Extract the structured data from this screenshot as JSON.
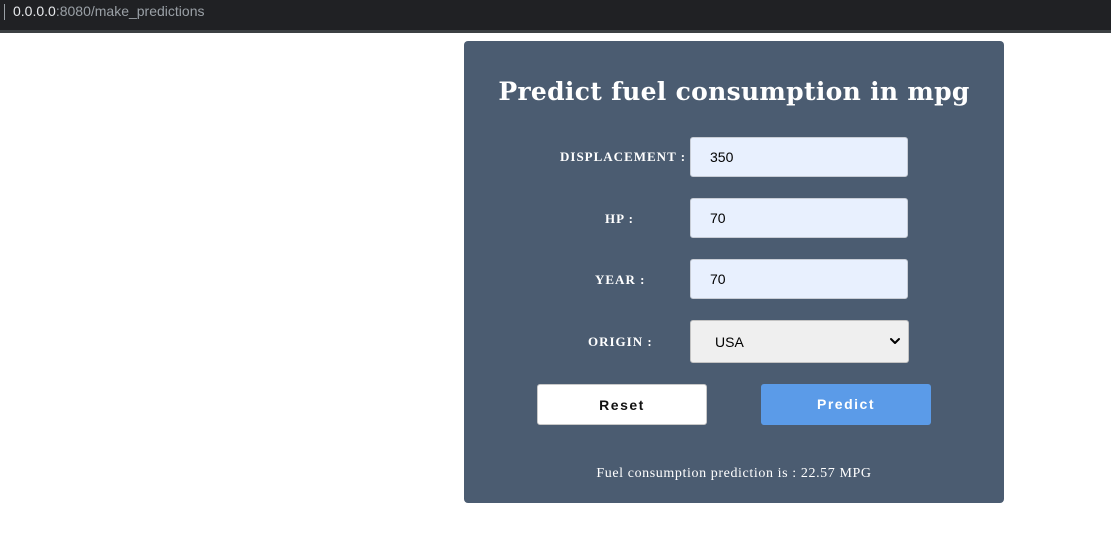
{
  "browser": {
    "url_host": "0.0.0.0",
    "url_rest": ":8080/make_predictions"
  },
  "form": {
    "title": "Predict fuel consumption in mpg",
    "fields": [
      {
        "label": "DISPLACEMENT :",
        "value": "350"
      },
      {
        "label": "HP :",
        "value": "70"
      },
      {
        "label": "YEAR :",
        "value": "70"
      }
    ],
    "origin": {
      "label": "ORIGIN :",
      "selected": "USA"
    },
    "reset_label": "Reset",
    "predict_label": "Predict",
    "result_text": "Fuel consumption prediction is : 22.57 MPG"
  },
  "colors": {
    "card_bg": "#4b5c71",
    "predict_button": "#5b9be8",
    "input_bg": "#e8f0fe"
  },
  "icons": {
    "select_arrow": "chevron-down-icon"
  }
}
